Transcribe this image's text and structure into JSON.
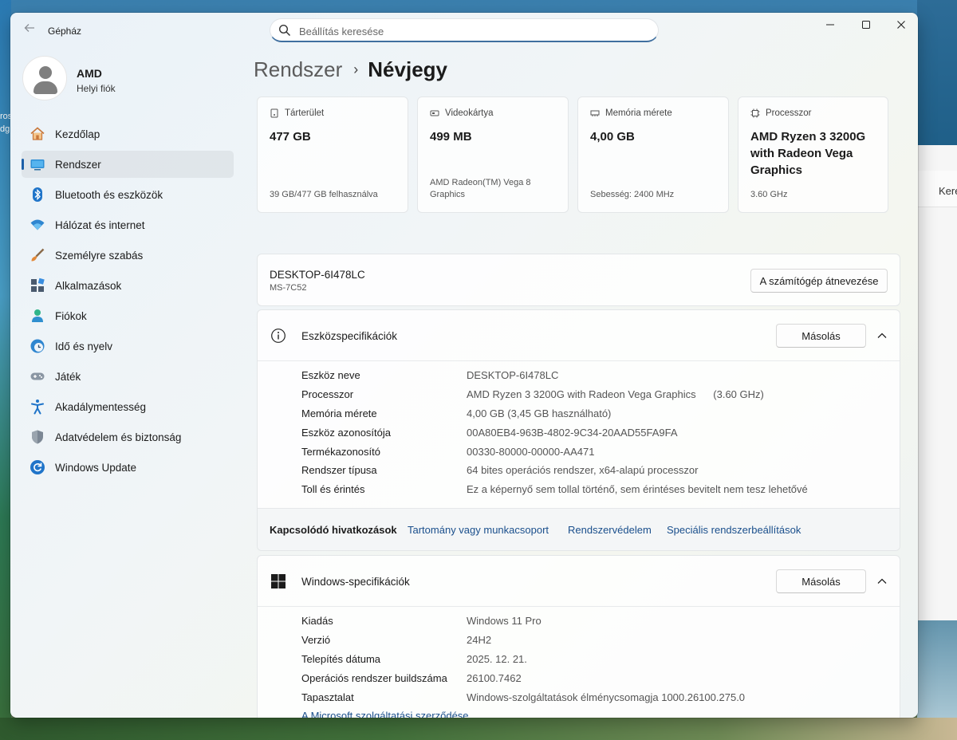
{
  "window": {
    "title": "Gépház"
  },
  "search": {
    "placeholder": "Beállítás keresése"
  },
  "profile": {
    "name": "AMD",
    "account_type": "Helyi fiók"
  },
  "nav": {
    "items": [
      {
        "label": "Kezdőlap",
        "icon": "home-icon"
      },
      {
        "label": "Rendszer",
        "icon": "system-icon",
        "active": true
      },
      {
        "label": "Bluetooth és eszközök",
        "icon": "bluetooth-icon"
      },
      {
        "label": "Hálózat és internet",
        "icon": "wifi-icon"
      },
      {
        "label": "Személyre szabás",
        "icon": "brush-icon"
      },
      {
        "label": "Alkalmazások",
        "icon": "apps-icon"
      },
      {
        "label": "Fiókok",
        "icon": "account-icon"
      },
      {
        "label": "Idő és nyelv",
        "icon": "clock-globe-icon"
      },
      {
        "label": "Játék",
        "icon": "gamepad-icon"
      },
      {
        "label": "Akadálymentesség",
        "icon": "accessibility-icon"
      },
      {
        "label": "Adatvédelem és biztonság",
        "icon": "shield-icon"
      },
      {
        "label": "Windows Update",
        "icon": "update-icon"
      }
    ]
  },
  "breadcrumb": {
    "parent": "Rendszer",
    "current": "Névjegy"
  },
  "cards": [
    {
      "label": "Tárterület",
      "value": "477 GB",
      "sub": "39 GB/477 GB felhasználva",
      "icon": "storage-icon"
    },
    {
      "label": "Videokártya",
      "value": "499 MB",
      "sub": "AMD Radeon(TM) Vega 8 Graphics",
      "icon": "gpu-icon"
    },
    {
      "label": "Memória mérete",
      "value": "4,00 GB",
      "sub": "Sebesség: 2400 MHz",
      "icon": "memory-icon"
    },
    {
      "label": "Processzor",
      "value": "AMD Ryzen 3 3200G with Radeon Vega Graphics",
      "sub": "3.60 GHz",
      "icon": "cpu-icon"
    }
  ],
  "device": {
    "name": "DESKTOP-6I478LC",
    "model": "MS-7C52",
    "rename_button": "A számítógép átnevezése"
  },
  "device_spec": {
    "title": "Eszközspecifikációk",
    "copy_button": "Másolás",
    "rows": [
      {
        "key": "Eszköz neve",
        "value": "DESKTOP-6I478LC"
      },
      {
        "key": "Processzor",
        "value": "AMD Ryzen 3 3200G with Radeon Vega Graphics      (3.60 GHz)"
      },
      {
        "key": "Memória mérete",
        "value": "4,00 GB (3,45 GB használható)"
      },
      {
        "key": "Eszköz azonosítója",
        "value": "00A80EB4-963B-4802-9C34-20AAD55FA9FA"
      },
      {
        "key": "Termékazonosító",
        "value": "00330-80000-00000-AA471"
      },
      {
        "key": "Rendszer típusa",
        "value": "64 bites operációs rendszer, x64-alapú processzor"
      },
      {
        "key": "Toll és érintés",
        "value": "Ez a képernyő sem tollal történő, sem érintéses bevitelt nem tesz lehetővé"
      }
    ]
  },
  "related_links": {
    "label": "Kapcsolódó hivatkozások",
    "links": [
      "Tartomány vagy munkacsoport",
      "Rendszervédelem",
      "Speciális rendszerbeállítások"
    ]
  },
  "windows_spec": {
    "title": "Windows-specifikációk",
    "copy_button": "Másolás",
    "rows": [
      {
        "key": "Kiadás",
        "value": "Windows 11 Pro"
      },
      {
        "key": "Verzió",
        "value": "24H2"
      },
      {
        "key": "Telepítés dátuma",
        "value": "2025. 12. 21."
      },
      {
        "key": "Operációs rendszer buildszáma",
        "value": "26100.7462"
      },
      {
        "key": "Tapasztalat",
        "value": "Windows-szolgáltatások élménycsomagja 1000.26100.275.0"
      }
    ],
    "ms_link": "A Microsoft szolgáltatási szerződése"
  },
  "background_window": {
    "text": "Kere"
  },
  "desktop_text": [
    "ros",
    "dg"
  ],
  "colors": {
    "accent": "#1c5fa8",
    "link": "#1a4f8c"
  }
}
